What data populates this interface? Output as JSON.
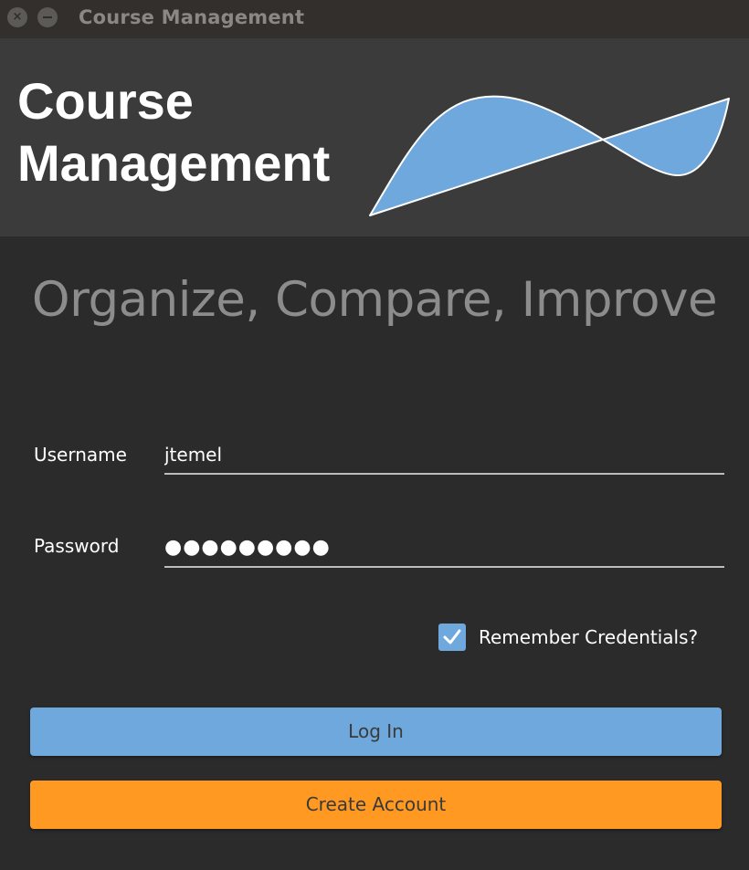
{
  "window": {
    "title": "Course Management",
    "close_glyph": "×"
  },
  "header": {
    "title_line1": "Course",
    "title_line2": "Management",
    "logo_icon": "wave-logo-icon",
    "logo_color": "#6fa8dc"
  },
  "tagline": "Organize, Compare, Improve",
  "form": {
    "username_label": "Username",
    "username_value": "jtemel",
    "password_label": "Password",
    "password_value": "●●●●●●●●●",
    "remember_label": "Remember Credentials?",
    "remember_checked": true
  },
  "buttons": {
    "login_label": "Log In",
    "create_label": "Create Account"
  },
  "colors": {
    "accent_blue": "#6fa8dc",
    "accent_orange": "#ff9922",
    "background": "#2b2b2b",
    "header_background": "#3b3b3b"
  }
}
